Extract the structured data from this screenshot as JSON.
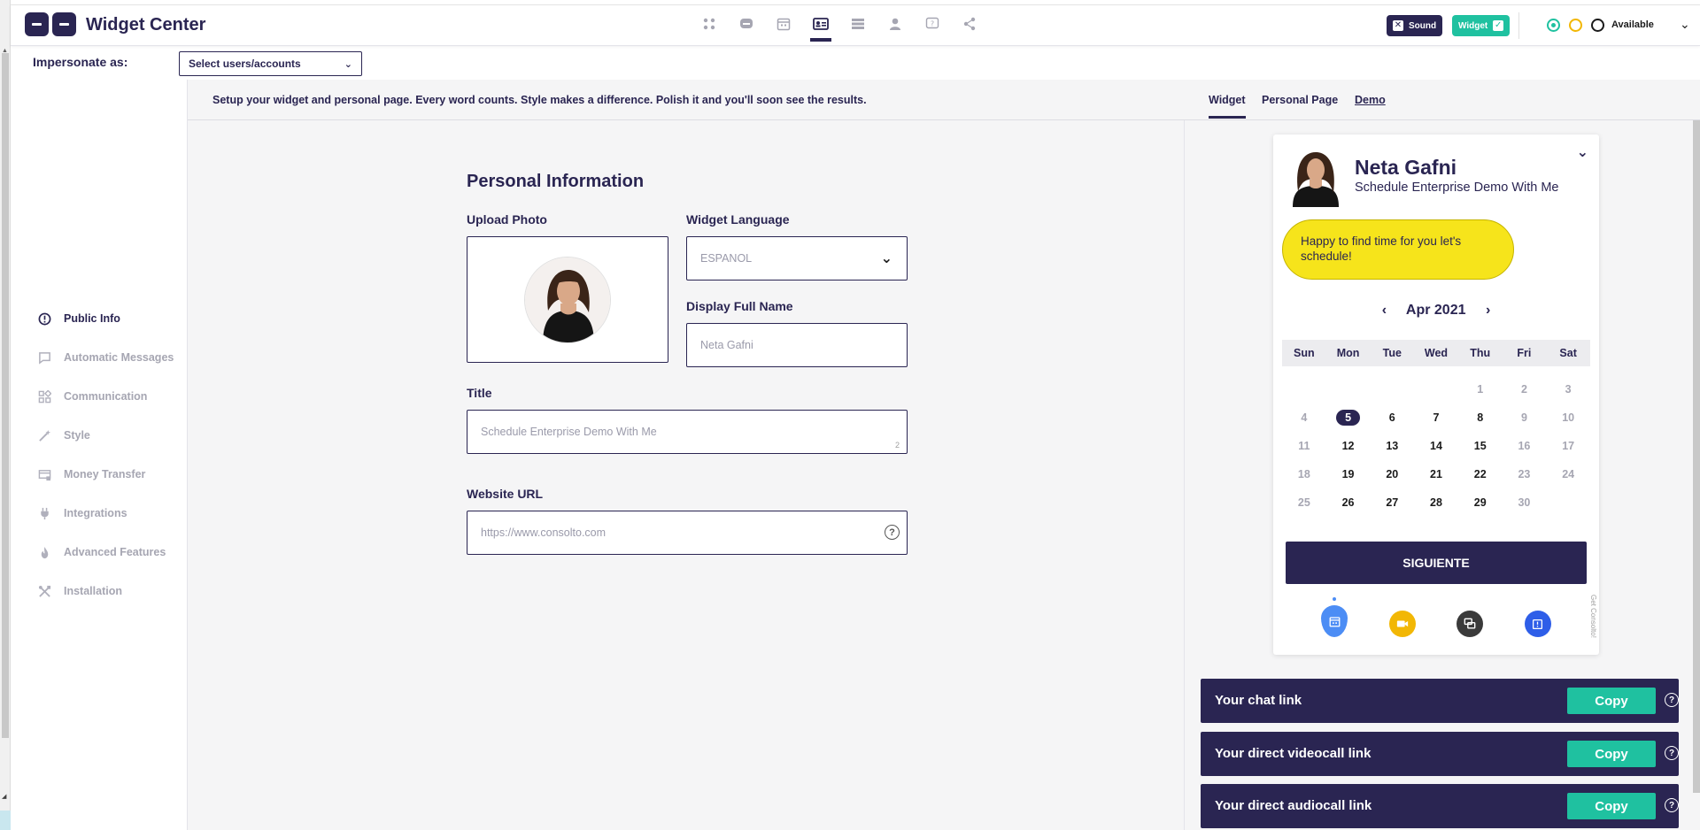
{
  "app": {
    "title": "Widget Center"
  },
  "header": {
    "nav_icons": [
      "grid-icon",
      "chat-icon",
      "calendar-icon",
      "id-card-icon",
      "list-icon",
      "user-icon",
      "help-icon",
      "share-icon"
    ],
    "sound_label": "Sound",
    "widget_label": "Widget",
    "status_label": "Available"
  },
  "impersonate": {
    "label": "Impersonate as:",
    "placeholder": "Select users/accounts"
  },
  "sidebar": {
    "items": [
      {
        "label": "Public Info",
        "icon": "info-icon"
      },
      {
        "label": "Automatic Messages",
        "icon": "message-icon"
      },
      {
        "label": "Communication",
        "icon": "apps-icon"
      },
      {
        "label": "Style",
        "icon": "magic-wand-icon"
      },
      {
        "label": "Money Transfer",
        "icon": "money-icon"
      },
      {
        "label": "Integrations",
        "icon": "plug-icon"
      },
      {
        "label": "Advanced Features",
        "icon": "flame-icon"
      },
      {
        "label": "Installation",
        "icon": "tools-icon"
      }
    ]
  },
  "main": {
    "intro": "Setup your widget and personal page. Every word counts. Style makes a difference. Polish it and you'll soon see the results.",
    "section_title": "Personal Information",
    "upload_photo_label": "Upload Photo",
    "widget_language_label": "Widget Language",
    "widget_language_value": "ESPANOL",
    "display_name_label": "Display Full Name",
    "display_name_value": "Neta Gafni",
    "title_label": "Title",
    "title_value": "Schedule Enterprise Demo With Me",
    "title_counter": "2",
    "website_label": "Website URL",
    "website_placeholder": "https://www.consolto.com"
  },
  "right_panel": {
    "tabs": [
      "Widget",
      "Personal Page",
      "Demo"
    ],
    "widget": {
      "name": "Neta Gafni",
      "subtitle": "Schedule Enterprise Demo With Me",
      "bubble": "Happy to find time for you let's schedule!",
      "month": "Apr 2021",
      "weekdays": [
        "Sun",
        "Mon",
        "Tue",
        "Wed",
        "Thu",
        "Fri",
        "Sat"
      ],
      "days": [
        {
          "d": "",
          "s": "empty"
        },
        {
          "d": "",
          "s": "empty"
        },
        {
          "d": "",
          "s": "empty"
        },
        {
          "d": "",
          "s": "empty"
        },
        {
          "d": "1",
          "s": "off"
        },
        {
          "d": "2",
          "s": "off"
        },
        {
          "d": "3",
          "s": "off"
        },
        {
          "d": "4",
          "s": "off"
        },
        {
          "d": "5",
          "s": "selected"
        },
        {
          "d": "6",
          "s": "avail"
        },
        {
          "d": "7",
          "s": "avail"
        },
        {
          "d": "8",
          "s": "avail"
        },
        {
          "d": "9",
          "s": "off"
        },
        {
          "d": "10",
          "s": "off"
        },
        {
          "d": "11",
          "s": "off"
        },
        {
          "d": "12",
          "s": "avail"
        },
        {
          "d": "13",
          "s": "avail"
        },
        {
          "d": "14",
          "s": "avail"
        },
        {
          "d": "15",
          "s": "avail"
        },
        {
          "d": "16",
          "s": "off"
        },
        {
          "d": "17",
          "s": "off"
        },
        {
          "d": "18",
          "s": "off"
        },
        {
          "d": "19",
          "s": "avail"
        },
        {
          "d": "20",
          "s": "avail"
        },
        {
          "d": "21",
          "s": "avail"
        },
        {
          "d": "22",
          "s": "avail"
        },
        {
          "d": "23",
          "s": "off"
        },
        {
          "d": "24",
          "s": "off"
        },
        {
          "d": "25",
          "s": "off"
        },
        {
          "d": "26",
          "s": "avail"
        },
        {
          "d": "27",
          "s": "avail"
        },
        {
          "d": "28",
          "s": "avail"
        },
        {
          "d": "29",
          "s": "avail"
        },
        {
          "d": "30",
          "s": "off"
        },
        {
          "d": "",
          "s": "empty"
        }
      ],
      "next_label": "SIGUIENTE",
      "branding": "Get Consolto!"
    },
    "links": [
      {
        "label": "Your chat link",
        "copy": "Copy"
      },
      {
        "label": "Your direct videocall link",
        "copy": "Copy"
      },
      {
        "label": "Your direct audiocall link",
        "copy": "Copy"
      }
    ]
  },
  "colors": {
    "primary": "#2a2552",
    "accent": "#1fc1a0",
    "bubble": "#f6e41b",
    "background": "#f5f5f6"
  }
}
